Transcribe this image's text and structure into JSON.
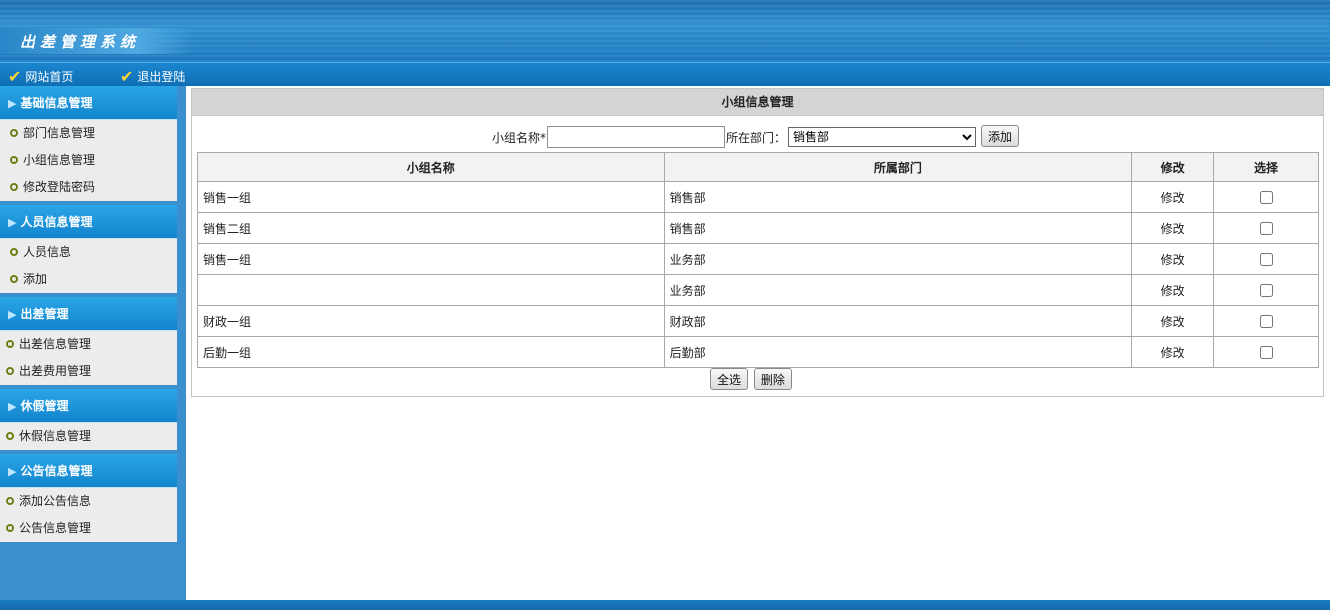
{
  "header": {
    "title": "出差管理系统"
  },
  "nav": [
    {
      "label": "网站首页"
    },
    {
      "label": "退出登陆"
    }
  ],
  "sidebar": {
    "groups": [
      {
        "title": "基础信息管理",
        "items": [
          {
            "label": "部门信息管理"
          },
          {
            "label": "小组信息管理"
          },
          {
            "label": "修改登陆密码"
          }
        ]
      },
      {
        "title": "人员信息管理",
        "items": [
          {
            "label": "人员信息"
          },
          {
            "label": "添加"
          }
        ]
      },
      {
        "title": "出差管理",
        "items": [
          {
            "label": "出差信息管理"
          },
          {
            "label": "出差费用管理"
          }
        ]
      },
      {
        "title": "休假管理",
        "items": [
          {
            "label": "休假信息管理"
          }
        ]
      },
      {
        "title": "公告信息管理",
        "items": [
          {
            "label": "添加公告信息"
          },
          {
            "label": "公告信息管理"
          }
        ]
      }
    ]
  },
  "main": {
    "panel_title": "小组信息管理",
    "form": {
      "group_name_label": "小组名称*",
      "group_name_value": "",
      "department_label": "所在部门：",
      "department_selected": "销售部",
      "add_button": "添加"
    },
    "table": {
      "headers": [
        "小组名称",
        "所属部门",
        "修改",
        "选择"
      ],
      "rows": [
        {
          "name": "销售一组",
          "dept": "销售部",
          "edit": "修改"
        },
        {
          "name": "销售二组",
          "dept": "销售部",
          "edit": "修改"
        },
        {
          "name": "销售一组",
          "dept": "业务部",
          "edit": "修改"
        },
        {
          "name": "",
          "dept": "业务部",
          "edit": "修改"
        },
        {
          "name": "财政一组",
          "dept": "财政部",
          "edit": "修改"
        },
        {
          "name": "后勤一组",
          "dept": "后勤部",
          "edit": "修改"
        }
      ]
    },
    "select_all_button": "全选",
    "delete_button": "删除"
  },
  "colors": {
    "header_blue": "#1b78bd",
    "sidebar_head": "#1285cd",
    "sidebar_bg": "#3a8fce",
    "check_yellow": "#f6d23a"
  }
}
